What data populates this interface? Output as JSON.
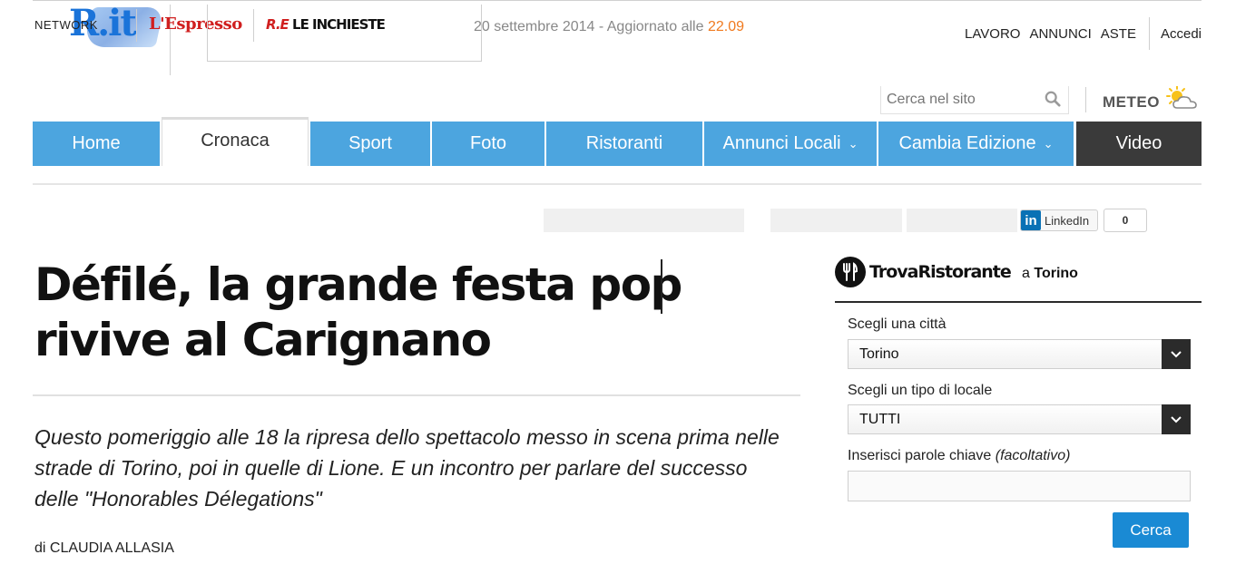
{
  "header": {
    "network_label": "NETWORK",
    "logo_mark": "R.it",
    "espresso_logo": "L'Espresso",
    "inchieste_prefix": "R.E",
    "inchieste_logo": "LE INCHIESTE",
    "date_text": "20 settembre 2014 - Aggiornato alle",
    "update_time": "22.09",
    "links": [
      "LAVORO",
      "ANNUNCI",
      "ASTE"
    ],
    "login": "Accedi"
  },
  "search": {
    "placeholder": "Cerca nel sito"
  },
  "meteo": {
    "label": "METEO",
    "icon": "weather-sun-cloud-icon"
  },
  "nav": {
    "items": [
      {
        "label": "Home"
      },
      {
        "label": "Cronaca",
        "active": true
      },
      {
        "label": "Sport"
      },
      {
        "label": "Foto"
      },
      {
        "label": "Ristoranti"
      },
      {
        "label": "Annunci Locali",
        "dropdown": true
      },
      {
        "label": "Cambia Edizione",
        "dropdown": true
      },
      {
        "label": "Video"
      }
    ],
    "chevron": "⌄"
  },
  "colors": {
    "nav_blue": "#4ca5df",
    "video_bg": "#3a3a3a",
    "accent_orange": "#f07a1f",
    "button_blue": "#1a8ad4",
    "linkedin_blue": "#0a71b5"
  },
  "share": {
    "linkedin_label": "LinkedIn",
    "linkedin_count": "0"
  },
  "article": {
    "headline": "Défilé, la grande festa pop rivive al Carignano",
    "summary": "Questo pomeriggio alle 18 la ripresa dello spettacolo messo in scena prima nelle strade di Torino, poi in quelle di Lione. E un incontro per parlare del successo delle \"Honorables Délegations\"",
    "byline": "di CLAUDIA ALLASIA"
  },
  "trova": {
    "brand": "TrovaRistorante",
    "city_prefix": "a",
    "city": "Torino",
    "city_label": "Scegli una città",
    "city_value": "Torino",
    "type_label": "Scegli un tipo di locale",
    "type_value": "TUTTI",
    "keywords_label": "Inserisci parole chiave",
    "keywords_optional": "(facoltativo)",
    "search_button": "Cerca"
  }
}
